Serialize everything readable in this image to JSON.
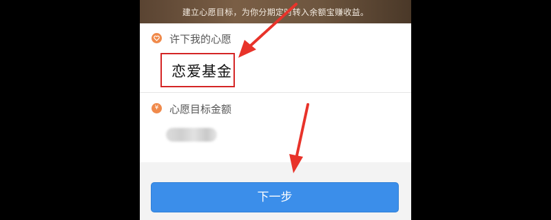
{
  "banner": {
    "text": "建立心愿目标，为你分期定时转入余额宝赚收益。"
  },
  "wish_field": {
    "icon": "heart-icon",
    "label": "许下我的心愿",
    "value": "恋爱基金"
  },
  "amount_field": {
    "icon": "yen-icon",
    "icon_glyph": "¥",
    "label": "心愿目标金额",
    "value_state": "blurred"
  },
  "next_button": {
    "label": "下一步"
  },
  "colors": {
    "accent": "#3b8eea",
    "icon": "#f08a4b",
    "annotation_red": "#e8332a"
  }
}
